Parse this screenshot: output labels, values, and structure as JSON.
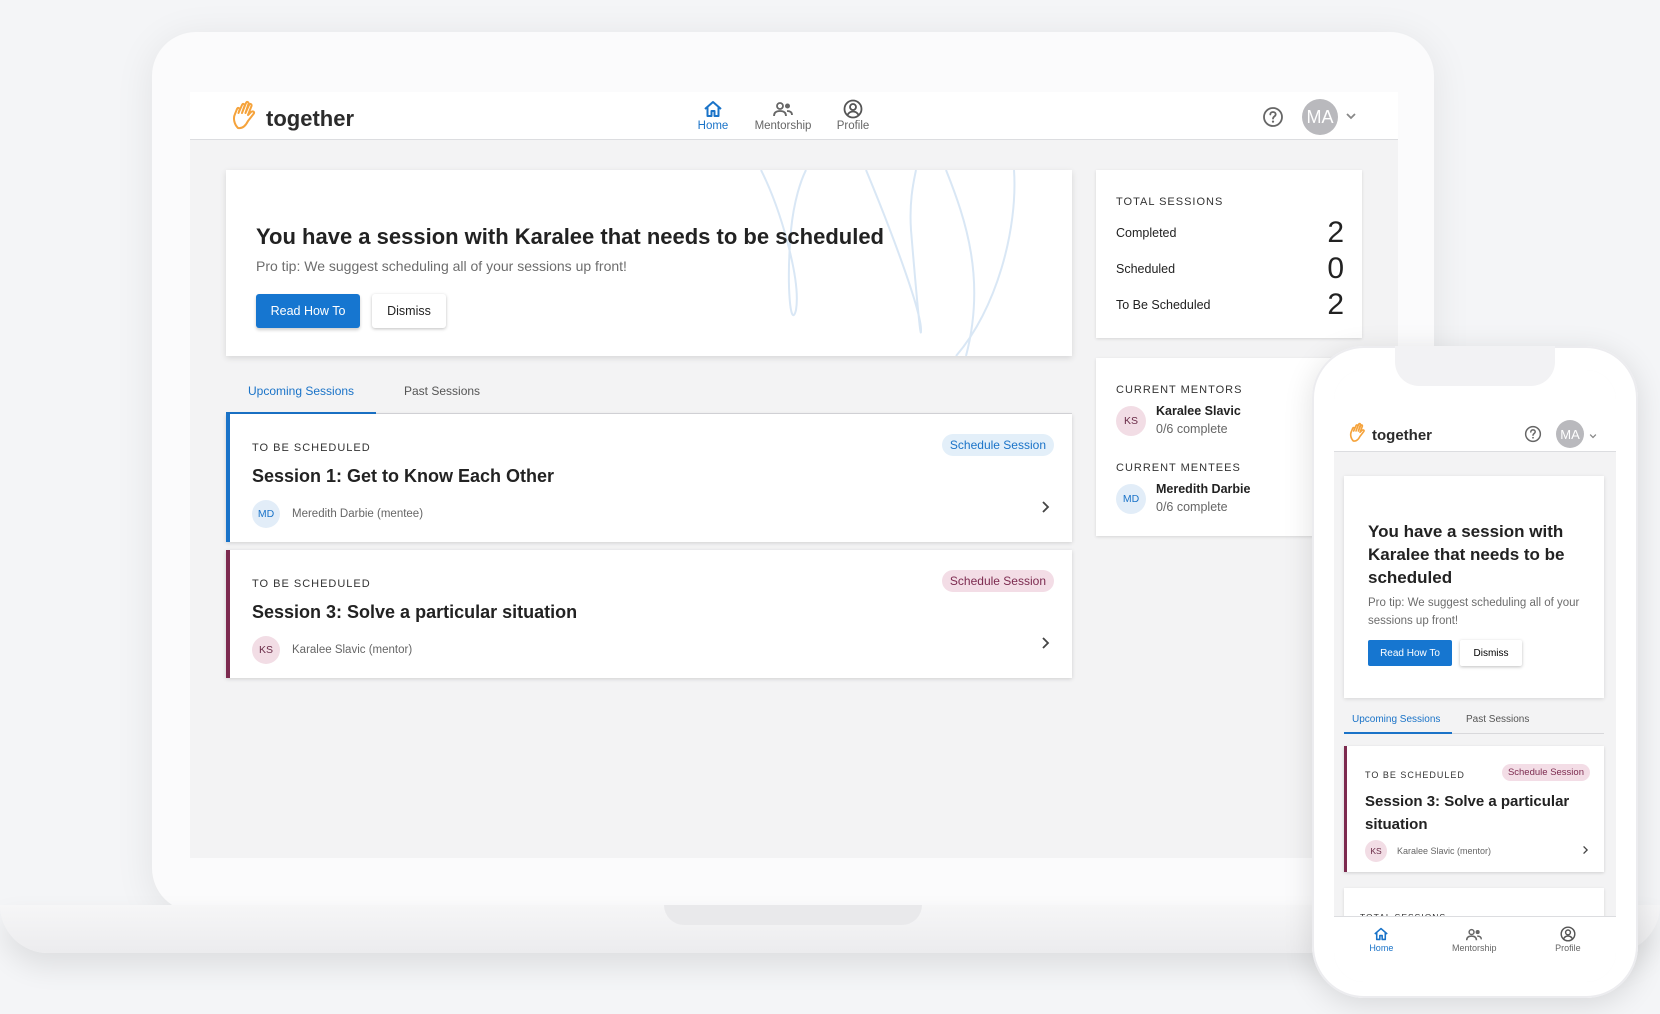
{
  "app": {
    "name": "together"
  },
  "nav": {
    "items": [
      {
        "label": "Home",
        "icon": "home-icon",
        "active": true
      },
      {
        "label": "Mentorship",
        "icon": "people-icon",
        "active": false
      },
      {
        "label": "Profile",
        "icon": "profile-icon",
        "active": false
      }
    ]
  },
  "user": {
    "initials": "MA"
  },
  "banner": {
    "title": "You have a session with Karalee that needs to be scheduled",
    "tip": "Pro tip: We suggest scheduling all of your sessions up front!",
    "primary_label": "Read How To",
    "secondary_label": "Dismiss"
  },
  "tabs": [
    {
      "label": "Upcoming Sessions",
      "active": true
    },
    {
      "label": "Past Sessions",
      "active": false
    }
  ],
  "sessions": [
    {
      "status": "TO BE SCHEDULED",
      "title": "Session 1: Get to Know Each Other",
      "badge": "Schedule Session",
      "person_initials": "MD",
      "person": "Meredith Darbie (mentee)",
      "color": "#1a73c8"
    },
    {
      "status": "TO BE SCHEDULED",
      "title": "Session 3: Solve a particular situation",
      "badge": "Schedule Session",
      "person_initials": "KS",
      "person": "Karalee Slavic (mentor)",
      "color": "#7c2a4f"
    }
  ],
  "totals": {
    "heading": "TOTAL SESSIONS",
    "rows": [
      {
        "label": "Completed",
        "value": "2"
      },
      {
        "label": "Scheduled",
        "value": "0"
      },
      {
        "label": "To Be Scheduled",
        "value": "2"
      }
    ]
  },
  "mentors": {
    "heading": "CURRENT MENTORS",
    "initials": "KS",
    "name": "Karalee Slavic",
    "progress": "0/6 complete"
  },
  "mentees": {
    "heading": "CURRENT MENTEES",
    "initials": "MD",
    "name": "Meredith Darbie",
    "progress": "0/6 complete"
  },
  "mobile": {
    "app_name": "together",
    "user_initials": "MA",
    "banner": {
      "title": "You have a session with Karalee that needs to be scheduled",
      "tip": "Pro tip: We suggest scheduling all of your sessions up front!",
      "primary_label": "Read How To",
      "secondary_label": "Dismiss"
    },
    "tabs": [
      {
        "label": "Upcoming Sessions",
        "active": true
      },
      {
        "label": "Past Sessions",
        "active": false
      }
    ],
    "session": {
      "status": "TO BE SCHEDULED",
      "badge": "Schedule Session",
      "title": "Session 3: Solve a particular situation",
      "person_initials": "KS",
      "person": "Karalee Slavic (mentor)"
    },
    "totals_heading": "TOTAL SESSIONS",
    "nav": [
      {
        "label": "Home",
        "active": true
      },
      {
        "label": "Mentorship",
        "active": false
      },
      {
        "label": "Profile",
        "active": false
      }
    ]
  },
  "colors": {
    "primary": "#1a73c8",
    "mentor_accent": "#7c2a4f",
    "logo": "#f5a33c"
  }
}
